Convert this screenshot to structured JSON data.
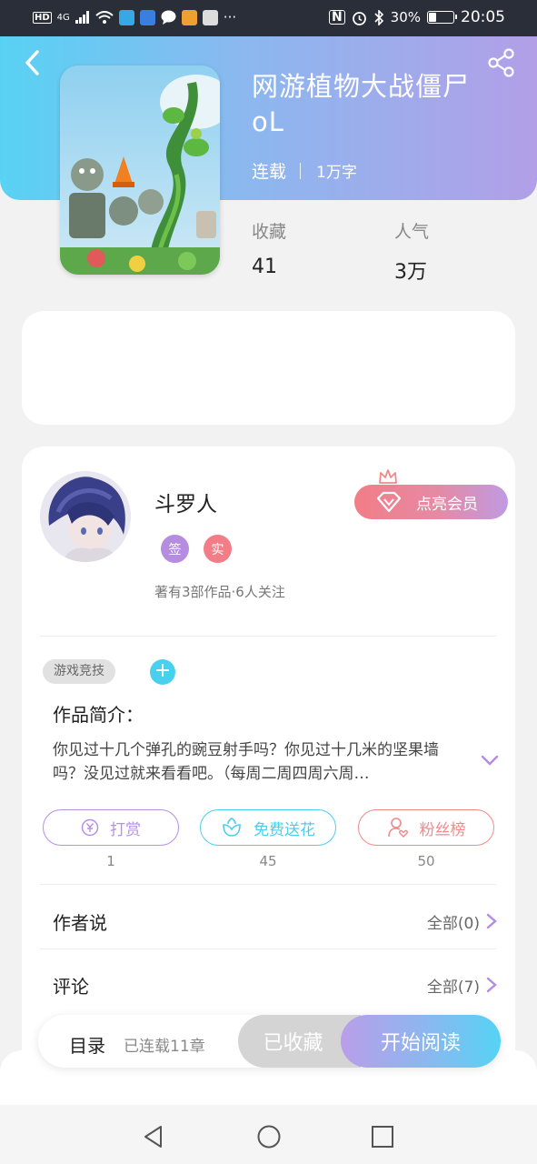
{
  "status_bar": {
    "network": "4G",
    "battery": "30%",
    "time": "20:05",
    "battery_level": 0.3,
    "more": "···"
  },
  "header": {
    "back_icon": "chevron-left-icon",
    "share_icon": "share-icon",
    "colors": {
      "gradient_start": "#58d2f3",
      "gradient_end": "#b29fe8"
    }
  },
  "book": {
    "title": "网游植物大战僵尸oL",
    "status": "连载",
    "words": "1万字",
    "stats": [
      {
        "label": "收藏",
        "value": "41"
      },
      {
        "label": "人气",
        "value": "3万"
      }
    ]
  },
  "author": {
    "name": "斗罗人",
    "badges": [
      {
        "text": "签",
        "color": "#b58ce0"
      },
      {
        "text": "实",
        "color": "#f27d86"
      }
    ],
    "meta": "著有3部作品·6人关注",
    "vip_label": "点亮会员"
  },
  "tags": {
    "items": [
      "游戏竞技"
    ],
    "add_label": "+"
  },
  "intro": {
    "title": "作品简介：",
    "text": "你见过十几个弹孔的豌豆射手吗？你见过十几米的坚果墙吗？没见过就来看看吧。（每周二周四周六周…"
  },
  "actions": [
    {
      "label": "打赏",
      "count": "1",
      "color": "#b78fe3",
      "icon": "yuan-coin-icon"
    },
    {
      "label": "免费送花",
      "count": "45",
      "color": "#4ccdef",
      "icon": "flower-icon"
    },
    {
      "label": "粉丝榜",
      "count": "50",
      "color": "#f08a8a",
      "icon": "fan-user-icon"
    }
  ],
  "rows": [
    {
      "title": "作者说",
      "right": "全部(0)"
    },
    {
      "title": "评论",
      "right": "全部(7)"
    }
  ],
  "bottom_bar": {
    "catalog": "目录",
    "catalog_count": "已连载11章",
    "collected": "已收藏",
    "start_read": "开始阅读"
  }
}
